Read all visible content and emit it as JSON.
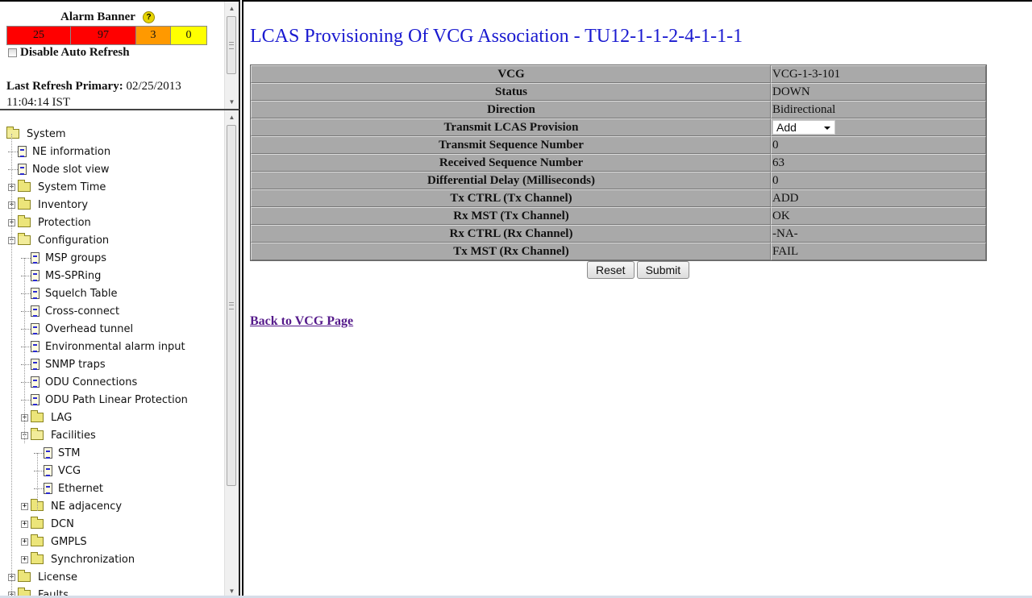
{
  "alarm_banner": {
    "title": "Alarm Banner",
    "help_icon": "question-mark-icon",
    "counts": [
      {
        "severity": "critical",
        "value": "25",
        "color": "#ff0000"
      },
      {
        "severity": "major",
        "value": "97",
        "color": "#ff0000"
      },
      {
        "severity": "minor",
        "value": "3",
        "color": "#ff9900"
      },
      {
        "severity": "warning",
        "value": "0",
        "color": "#ffff00"
      }
    ],
    "disable_auto_refresh_label": "Disable Auto Refresh",
    "disable_auto_refresh_checked": false,
    "last_refresh_label": "Last Refresh Primary:",
    "last_refresh_date": "02/25/2013",
    "last_refresh_time": "11:04:14 IST"
  },
  "tree": {
    "items": [
      {
        "label": "System",
        "type": "folder-open",
        "level": 0,
        "expander": ""
      },
      {
        "label": "NE information",
        "type": "doc",
        "level": 1
      },
      {
        "label": "Node slot view",
        "type": "doc",
        "level": 1
      },
      {
        "label": "System Time",
        "type": "folder",
        "level": 1,
        "expander": "+"
      },
      {
        "label": "Inventory",
        "type": "folder",
        "level": 1,
        "expander": "+"
      },
      {
        "label": "Protection",
        "type": "folder",
        "level": 1,
        "expander": "+"
      },
      {
        "label": "Configuration",
        "type": "folder-open",
        "level": 1,
        "expander": "-"
      },
      {
        "label": "MSP groups",
        "type": "doc",
        "level": 2
      },
      {
        "label": "MS-SPRing",
        "type": "doc",
        "level": 2
      },
      {
        "label": "Squelch Table",
        "type": "doc",
        "level": 2
      },
      {
        "label": "Cross-connect",
        "type": "doc",
        "level": 2
      },
      {
        "label": "Overhead tunnel",
        "type": "doc",
        "level": 2
      },
      {
        "label": "Environmental alarm input",
        "type": "doc",
        "level": 2
      },
      {
        "label": "SNMP traps",
        "type": "doc",
        "level": 2
      },
      {
        "label": "ODU Connections",
        "type": "doc",
        "level": 2
      },
      {
        "label": "ODU Path Linear Protection",
        "type": "doc",
        "level": 2
      },
      {
        "label": "LAG",
        "type": "folder",
        "level": 2,
        "expander": "+"
      },
      {
        "label": "Facilities",
        "type": "folder-open",
        "level": 2,
        "expander": "-"
      },
      {
        "label": "STM",
        "type": "doc",
        "level": 3
      },
      {
        "label": "VCG",
        "type": "doc",
        "level": 3
      },
      {
        "label": "Ethernet",
        "type": "doc",
        "level": 3
      },
      {
        "label": "NE adjacency",
        "type": "folder",
        "level": 2,
        "expander": "+"
      },
      {
        "label": "DCN",
        "type": "folder",
        "level": 2,
        "expander": "+"
      },
      {
        "label": "GMPLS",
        "type": "folder",
        "level": 2,
        "expander": "+"
      },
      {
        "label": "Synchronization",
        "type": "folder",
        "level": 2,
        "expander": "+"
      },
      {
        "label": "License",
        "type": "folder",
        "level": 1,
        "expander": "+"
      },
      {
        "label": "Faults",
        "type": "folder",
        "level": 1,
        "expander": "+"
      }
    ]
  },
  "main": {
    "title": "LCAS Provisioning Of VCG Association - TU12-1-1-2-4-1-1-1",
    "rows": [
      {
        "label": "VCG",
        "value": "VCG-1-3-101"
      },
      {
        "label": "Status",
        "value": "DOWN"
      },
      {
        "label": "Direction",
        "value": "Bidirectional"
      },
      {
        "label": "Transmit LCAS Provision",
        "value": "Add",
        "control": "select"
      },
      {
        "label": "Transmit Sequence Number",
        "value": "0"
      },
      {
        "label": "Received Sequence Number",
        "value": "63"
      },
      {
        "label": "Differential Delay (Milliseconds)",
        "value": "0"
      },
      {
        "label": "Tx CTRL (Tx Channel)",
        "value": "ADD"
      },
      {
        "label": "Rx MST (Tx Channel)",
        "value": "OK"
      },
      {
        "label": "Rx CTRL (Rx Channel)",
        "value": "-NA-"
      },
      {
        "label": "Tx MST (Rx Channel)",
        "value": "FAIL"
      }
    ],
    "reset_label": "Reset",
    "submit_label": "Submit",
    "back_link": "Back to VCG Page"
  }
}
